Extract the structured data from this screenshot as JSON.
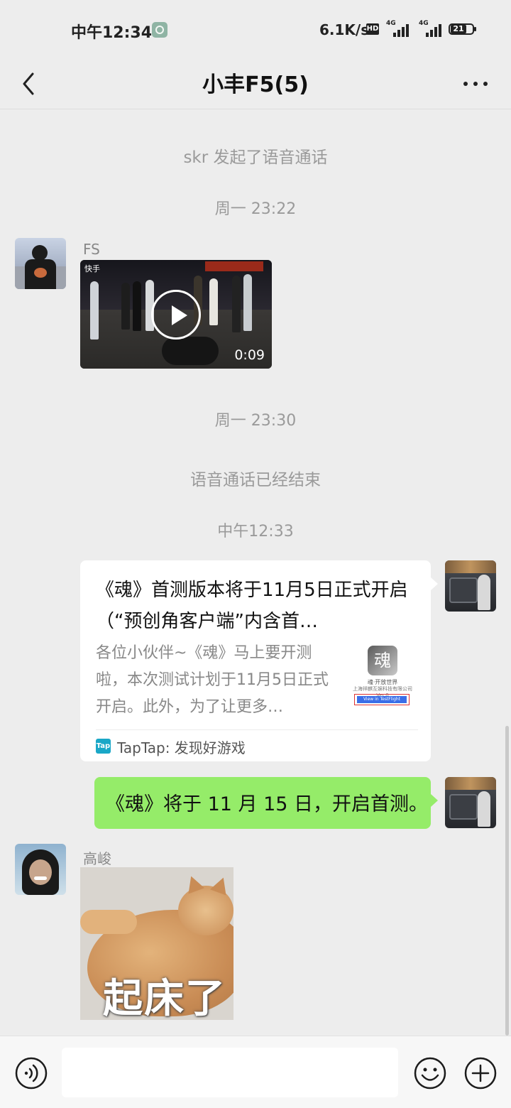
{
  "status_bar": {
    "time": "中午12:34",
    "net_speed": "6.1K/s",
    "hd": "HD",
    "network_1": "4G",
    "network_2": "4G",
    "battery": "21"
  },
  "header": {
    "title": "小丰F5(5)"
  },
  "messages": {
    "sys_call_started": "skr 发起了语音通话",
    "time_1": "周一 23:22",
    "fs_name": "FS",
    "video_duration": "0:09",
    "video_watermark": "快手",
    "time_2": "周一 23:30",
    "sys_call_ended": "语音通话已经结束",
    "time_3": "中午12:33",
    "link_card": {
      "title": "《魂》首测版本将于11月5日正式开启（“预创角客户端”内含首…",
      "description": "各位小伙伴~《魂》马上要开测啦，本次测试计划于11月5日正式开启。此外，为了让更多…",
      "thumb_logo": "魂",
      "thumb_line1": "魂·开放世界",
      "thumb_line2": "上海祥麒互娱科技有限公司 Ver.0",
      "thumb_button": "View in TestFlight",
      "source_icon": "Tap",
      "source": "TapTap: 发现好游戏"
    },
    "my_text": "《魂》将于 11 月 15 日，开启首测。",
    "gaojun_name": "高峻",
    "sticker_caption": "起床了"
  },
  "input": {
    "value": "",
    "placeholder": ""
  }
}
